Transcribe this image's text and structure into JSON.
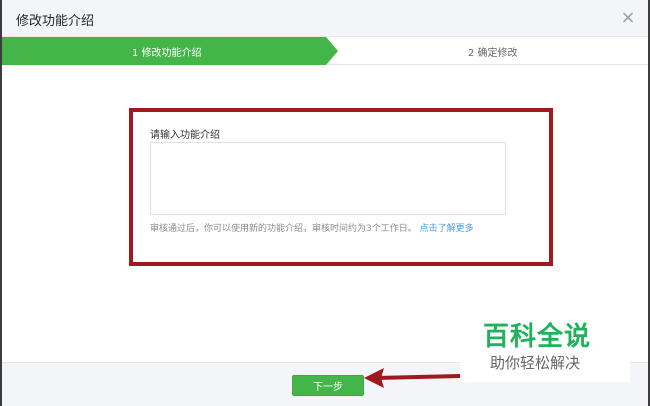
{
  "dialog": {
    "title": "修改功能介绍",
    "close_symbol": "×",
    "close_icon": "close-icon"
  },
  "steps": {
    "step1": "1 修改功能介绍",
    "step2": "2 确定修改",
    "active_color": "#44b549"
  },
  "form": {
    "label": "请输入功能介绍",
    "value": "",
    "hint_text": "审核通过后，你可以使用新的功能介绍，审核时间约为3个工作日。",
    "hint_link": "点击了解更多"
  },
  "footer": {
    "next_label": "下一步"
  },
  "annotation": {
    "highlight_color": "#9e1a1f"
  },
  "watermark": {
    "title": "百科全说",
    "subtitle": "助你轻松解决"
  }
}
